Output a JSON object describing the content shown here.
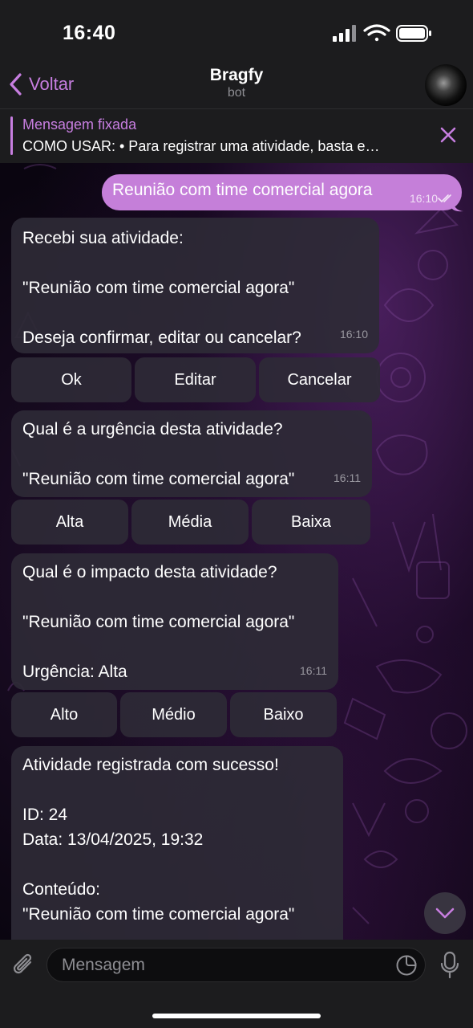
{
  "status_bar": {
    "time": "16:40"
  },
  "nav": {
    "back_label": "Voltar",
    "title": "Bragfy",
    "subtitle": "bot"
  },
  "pinned": {
    "title": "Mensagem fixada",
    "text": "COMO USAR: • Para registrar uma atividade, basta e…"
  },
  "outgoing": {
    "text": "Reunião com time comercial agora",
    "time": "16:10"
  },
  "messages": [
    {
      "lines": [
        "Recebi sua atividade:",
        "",
        "\"Reunião com time comercial agora\"",
        "",
        "Deseja confirmar, editar ou cancelar?"
      ],
      "time": "16:10",
      "buttons": [
        "Ok",
        "Editar",
        "Cancelar"
      ]
    },
    {
      "lines": [
        "Qual é a urgência desta atividade?",
        "",
        "\"Reunião com time comercial agora\""
      ],
      "time": "16:11",
      "buttons": [
        "Alta",
        "Média",
        "Baixa"
      ]
    },
    {
      "lines": [
        "Qual é o impacto desta atividade?",
        "",
        "\"Reunião com time comercial agora\"",
        "",
        "Urgência: Alta"
      ],
      "time": "16:11",
      "buttons": [
        "Alto",
        "Médio",
        "Baixo"
      ]
    },
    {
      "lines": [
        "Atividade registrada com sucesso!",
        "",
        "ID: 24",
        "Data: 13/04/2025, 19:32",
        "",
        "Conteúdo:",
        "\"Reunião com time comercial agora\""
      ]
    }
  ],
  "input": {
    "placeholder": "Mensagem"
  },
  "colors": {
    "accent": "#c77ee0",
    "outgoing_bubble": "#c57fd9",
    "incoming_bubble": "#2e2a36",
    "bar": "#1c1c1e"
  }
}
